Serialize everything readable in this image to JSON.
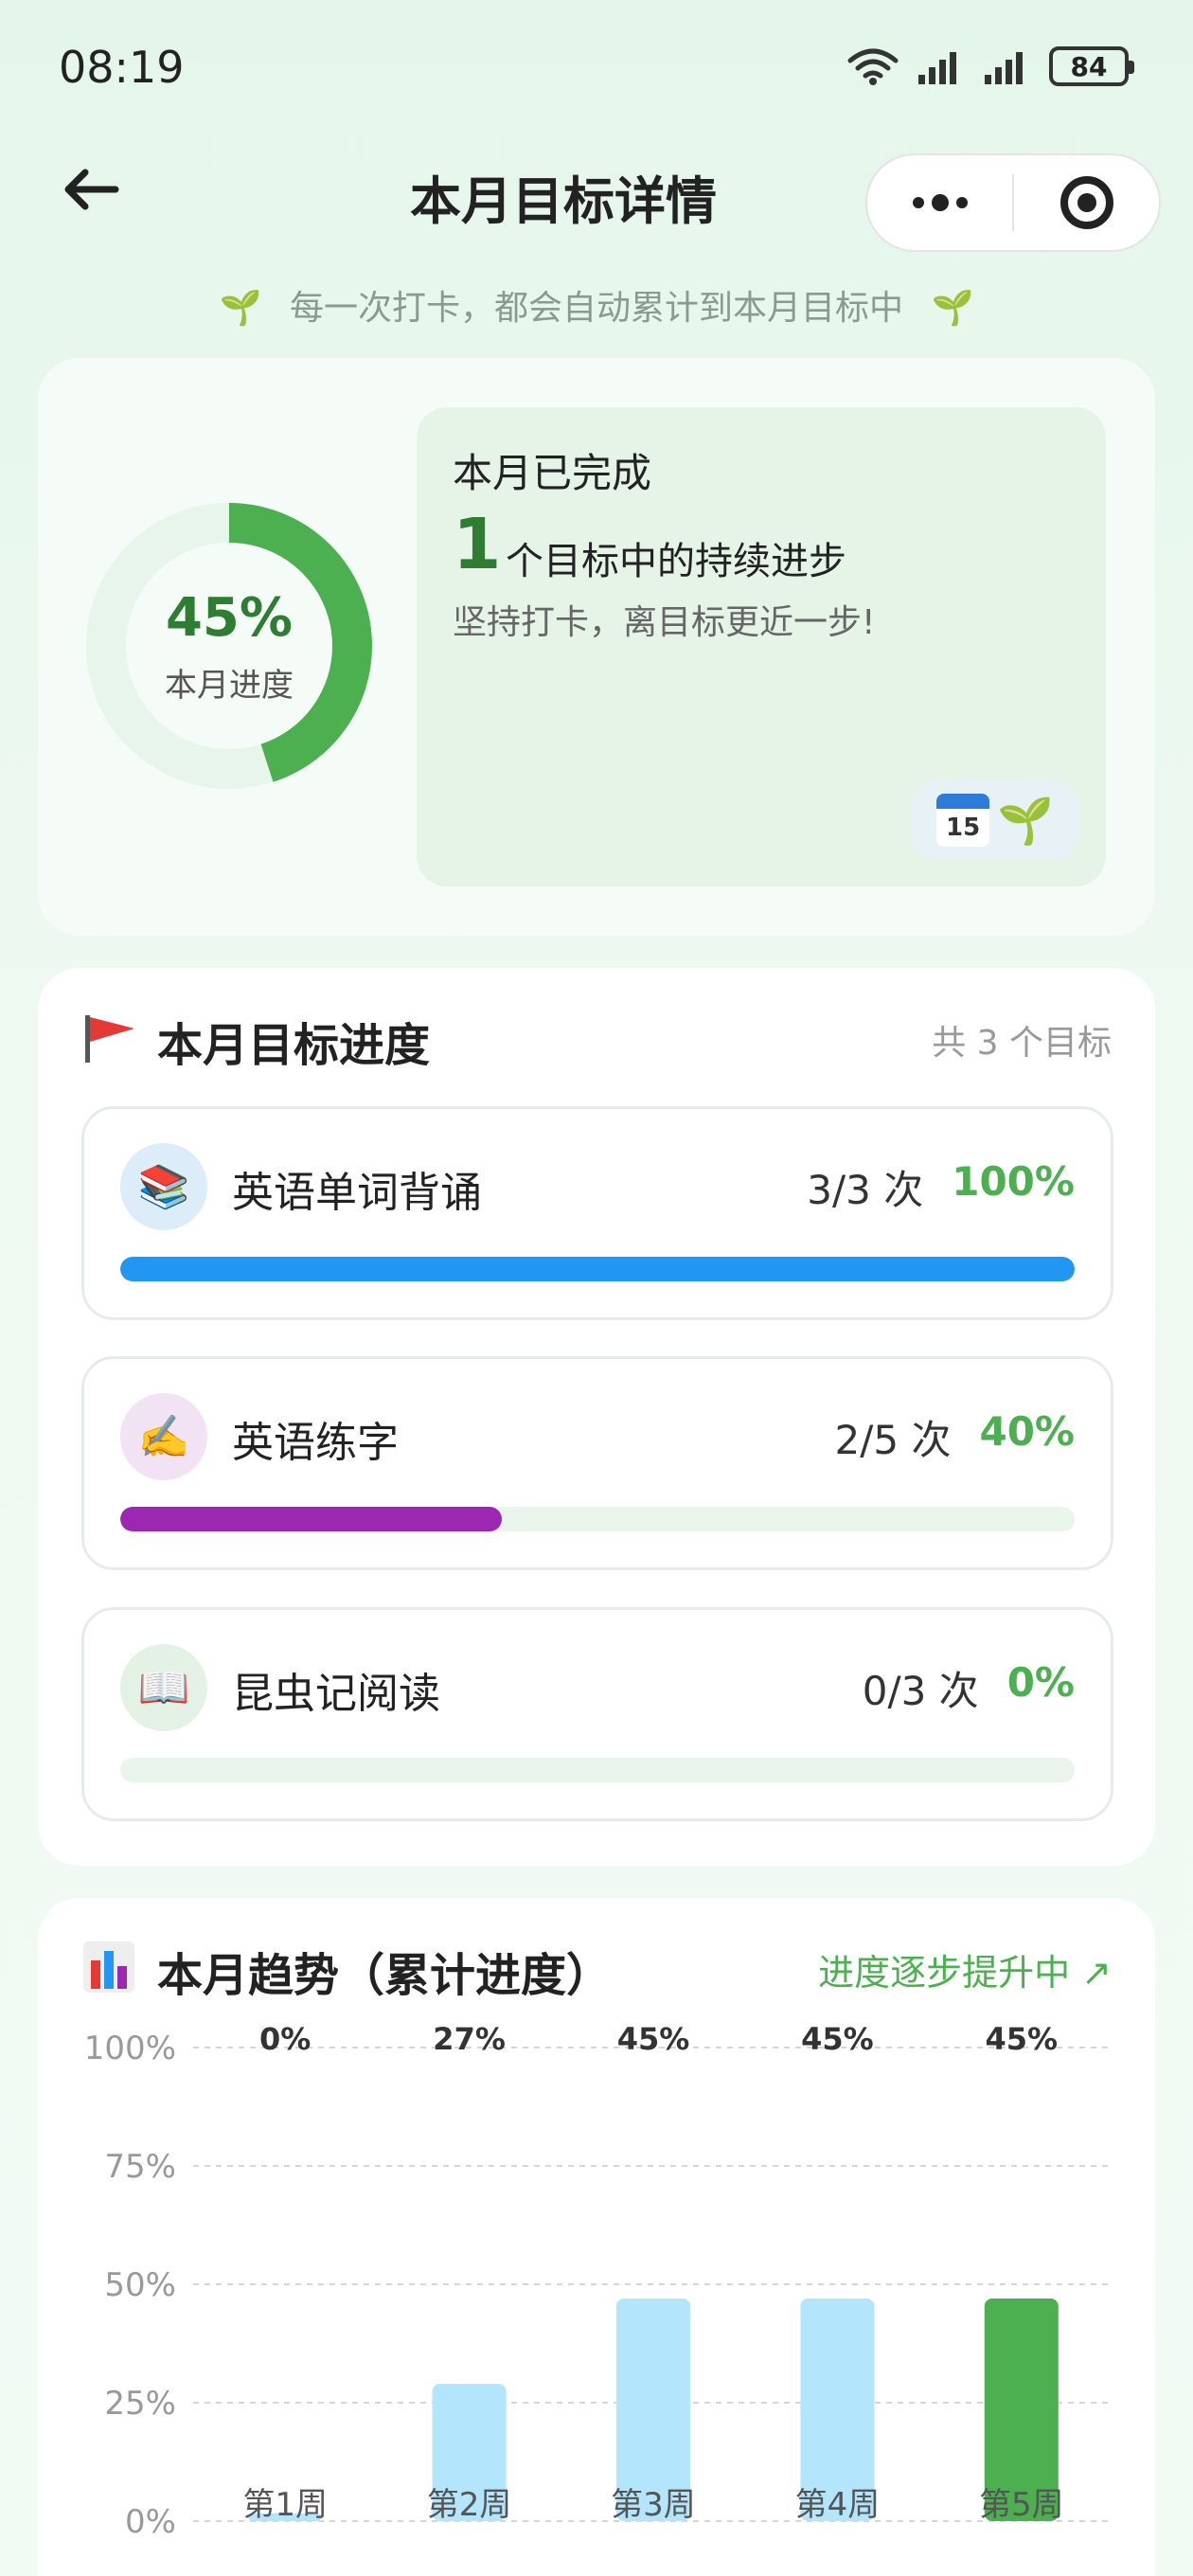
{
  "status": {
    "time": "08:19",
    "battery": "84"
  },
  "nav": {
    "title": "本月目标详情"
  },
  "tip": "每一次打卡，都会自动累计到本月目标中",
  "summary": {
    "percent": "45%",
    "percent_value": 45,
    "percent_label": "本月进度",
    "panel_title": "本月已完成",
    "count": "1",
    "count_text": "个目标中的持续进步",
    "subtitle": "坚持打卡，离目标更近一步!",
    "badge_day": "15"
  },
  "goals_section": {
    "title": "本月目标进度",
    "count_label": "共 3 个目标",
    "items": [
      {
        "name": "英语单词背诵",
        "icon": "books-icon",
        "icon_glyph": "📚",
        "icon_bg": "#dcecf8",
        "times": "3/3 次",
        "pct": "100%",
        "progress": 1.0,
        "color": "#2196f3"
      },
      {
        "name": "英语练字",
        "icon": "writing-hand-icon",
        "icon_glyph": "✍️",
        "icon_bg": "#f1e2f4",
        "times": "2/5 次",
        "pct": "40%",
        "progress": 0.4,
        "color": "#9c27b0"
      },
      {
        "name": "昆虫记阅读",
        "icon": "open-book-icon",
        "icon_glyph": "📖",
        "icon_bg": "#e3f2e5",
        "times": "0/3 次",
        "pct": "0%",
        "progress": 0.0,
        "color": "#4caf50"
      }
    ]
  },
  "trend_section": {
    "title": "本月趋势（累计进度）",
    "trend_label": "进度逐步提升中 ↗"
  },
  "chart_data": {
    "type": "bar",
    "categories": [
      "第1周",
      "第2周",
      "第3周",
      "第4周",
      "第5周"
    ],
    "values": [
      0,
      27,
      45,
      45,
      45
    ],
    "value_labels": [
      "0%",
      "27%",
      "45%",
      "45%",
      "45%"
    ],
    "y_ticks": [
      "100%",
      "75%",
      "50%",
      "25%",
      "0%"
    ],
    "ylim": [
      0,
      100
    ],
    "grid": true,
    "bar_color": "#b3e5fc",
    "highlight_color": "#4caf50",
    "highlight_index": 4
  }
}
